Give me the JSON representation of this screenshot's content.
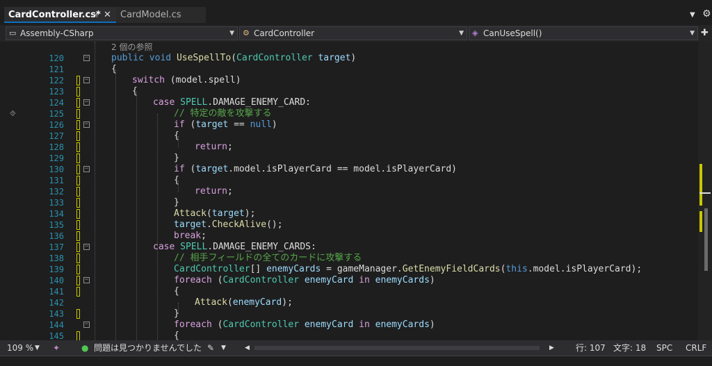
{
  "tabs": [
    {
      "label": "CardController.cs*",
      "active": true
    },
    {
      "label": "CardModel.cs",
      "active": false
    }
  ],
  "tab_icons": {
    "pin": "pin-icon",
    "close": "close-icon",
    "dropdown": "chevron-down-icon",
    "settings": "gear-icon"
  },
  "navbar": {
    "project": "Assembly-CSharp",
    "class": "CardController",
    "member": "CanUseSpell()"
  },
  "codelens": "2 個の参照",
  "lines": [
    {
      "n": "120"
    },
    {
      "n": "121"
    },
    {
      "n": "122"
    },
    {
      "n": "123"
    },
    {
      "n": "124"
    },
    {
      "n": "125"
    },
    {
      "n": "126"
    },
    {
      "n": "127"
    },
    {
      "n": "128"
    },
    {
      "n": "129"
    },
    {
      "n": "130"
    },
    {
      "n": "131"
    },
    {
      "n": "132"
    },
    {
      "n": "133"
    },
    {
      "n": "134"
    },
    {
      "n": "135"
    },
    {
      "n": "136"
    },
    {
      "n": "137"
    },
    {
      "n": "138"
    },
    {
      "n": "139"
    },
    {
      "n": "140"
    },
    {
      "n": "141"
    },
    {
      "n": "142"
    },
    {
      "n": "143"
    },
    {
      "n": "144"
    },
    {
      "n": "145"
    }
  ],
  "code": {
    "l120": {
      "a": "public",
      "b": "void",
      "c": "UseSpellTo",
      "d": "(",
      "e": "CardController",
      "f": "target",
      "g": ")"
    },
    "l121": "{",
    "l122": {
      "a": "switch",
      "b": " (model.spell)"
    },
    "l123": "{",
    "l124": {
      "a": "case",
      "b": "SPELL",
      "c": ".DAMAGE_ENEMY_CARD:"
    },
    "l125": "// 特定の敵を攻撃する",
    "l126": {
      "a": "if",
      "b": " (",
      "c": "target",
      "d": " == ",
      "e": "null",
      "f": ")"
    },
    "l127": "{",
    "l128": {
      "a": "return",
      "b": ";"
    },
    "l129": "}",
    "l130": {
      "a": "if",
      "b": " (",
      "c": "target",
      "d": ".model.isPlayerCard == model.isPlayerCard)"
    },
    "l131": "{",
    "l132": {
      "a": "return",
      "b": ";"
    },
    "l133": "}",
    "l134": {
      "a": "Attack",
      "b": "(",
      "c": "target",
      "d": ");"
    },
    "l135": {
      "a": "target",
      "b": ".",
      "c": "CheckAlive",
      "d": "();"
    },
    "l136": {
      "a": "break",
      "b": ";"
    },
    "l137": {
      "a": "case",
      "b": "SPELL",
      "c": ".DAMAGE_ENEMY_CARDS:"
    },
    "l138": "// 相手フィールドの全てのカードに攻撃する",
    "l139": {
      "a": "CardController",
      "b": "[] ",
      "c": "enemyCards",
      "d": " = gameManager.",
      "e": "GetEnemyFieldCards",
      "f": "(",
      "g": "this",
      "h": ".model.isPlayerCard);"
    },
    "l140": {
      "a": "foreach",
      "b": " (",
      "c": "CardController",
      "d": "enemyCard",
      "e": "in",
      "f": "enemyCards",
      "g": ")"
    },
    "l141": "{",
    "l142": {
      "a": "Attack",
      "b": "(",
      "c": "enemyCard",
      "d": ");"
    },
    "l143": "}",
    "l144": {
      "a": "foreach",
      "b": " (",
      "c": "CardController",
      "d": "enemyCard",
      "e": "in",
      "f": "enemyCards",
      "g": ")"
    },
    "l145": "{"
  },
  "status": {
    "zoom": "109 %",
    "issues": "問題は見つかりませんでした",
    "row": "行: 107",
    "col": "文字: 18",
    "spc": "SPC",
    "crlf": "CRLF"
  },
  "colors": {
    "keyword": "#569cd6",
    "control": "#d8a0df",
    "type": "#4ec9b0",
    "method": "#dcdcaa",
    "param": "#9cdcfe",
    "comment": "#57a64a",
    "linenum": "#2b91af",
    "accent": "#0e70c0"
  }
}
